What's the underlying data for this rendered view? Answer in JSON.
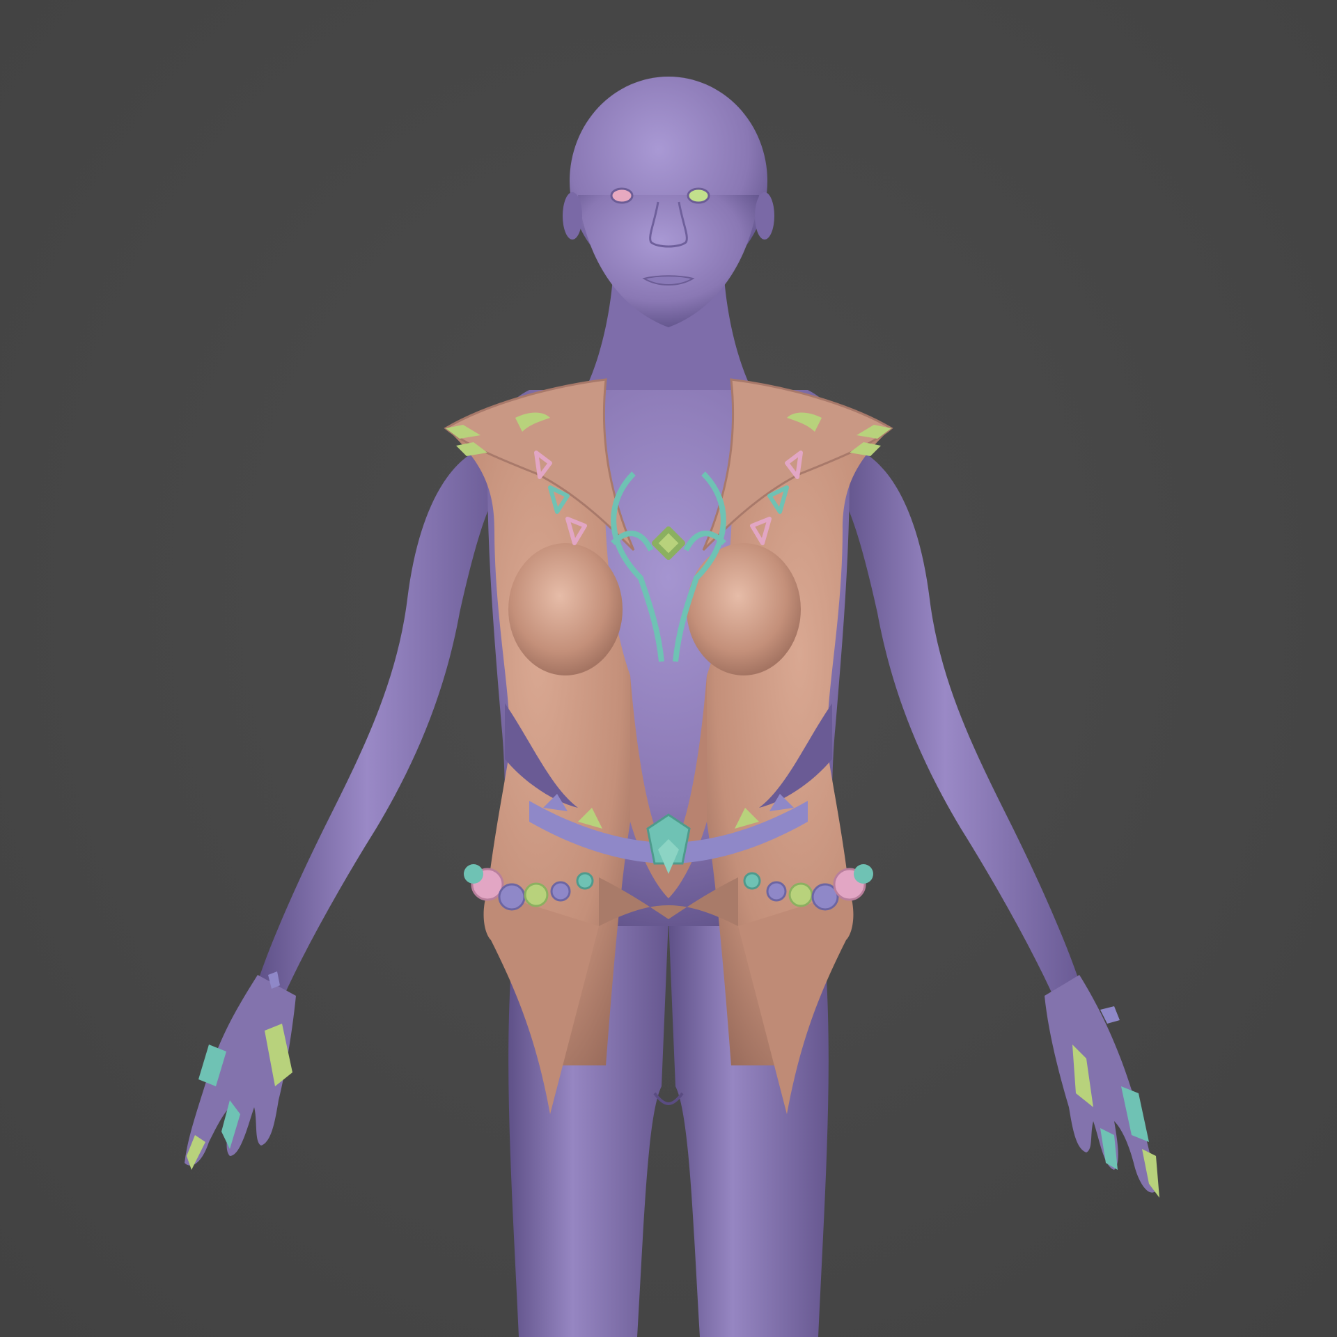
{
  "scene": {
    "subject": "sculpt-render",
    "colors": {
      "background": "#474747",
      "skin": "#8a78b4",
      "skin_shadow": "#5f5188",
      "skin_highlight": "#a999d4",
      "armor": "#c4907a",
      "armor_shadow": "#9a6c5c",
      "armor_highlight": "#dcae98",
      "accent_teal": "#6fc2b4",
      "accent_green": "#b8d27c",
      "accent_pink": "#e2a6c4",
      "accent_lavender": "#8f88c8",
      "eye_left": "#e7a9c0",
      "eye_right": "#c2e08c"
    },
    "icons": [
      "figure",
      "vest",
      "necklace",
      "belt",
      "finger-claws"
    ]
  }
}
